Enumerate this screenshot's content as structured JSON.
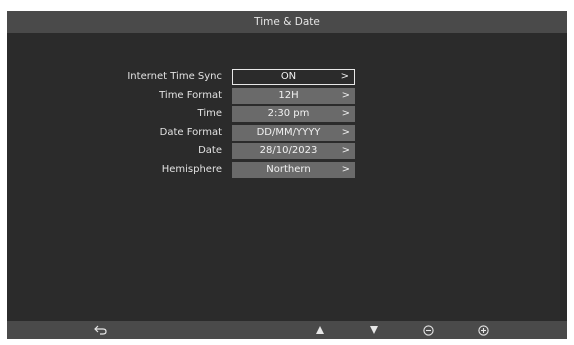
{
  "window": {
    "title": "Time & Date"
  },
  "settings": [
    {
      "label": "Internet Time Sync",
      "value": "ON",
      "selected": true
    },
    {
      "label": "Time Format",
      "value": "12H",
      "selected": false
    },
    {
      "label": "Time",
      "value": "2:30 pm",
      "selected": false
    },
    {
      "label": "Date Format",
      "value": "DD/MM/YYYY",
      "selected": false
    },
    {
      "label": "Date",
      "value": "28/10/2023",
      "selected": false
    },
    {
      "label": "Hemisphere",
      "value": "Northern",
      "selected": false
    }
  ],
  "chevron": ">",
  "bottom_bar": {
    "icons": [
      "back-icon",
      "up-arrow-icon",
      "down-arrow-icon",
      "minus-circle-icon",
      "plus-circle-icon"
    ]
  },
  "colors": {
    "screen_bg": "#2b2b2b",
    "bar_bg": "#4a4a4a",
    "value_bg": "#6a6a6a",
    "text": "#e2e2e2"
  }
}
